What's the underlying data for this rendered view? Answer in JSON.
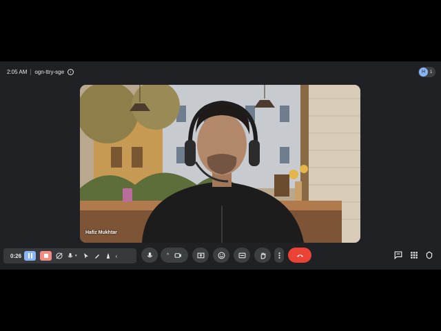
{
  "meeting": {
    "time": "2:05 AM",
    "code": "ogn-ttry-sge",
    "participant_initial": "H",
    "participant_count": "1"
  },
  "tile": {
    "name": "Hafiz Mukhtar"
  },
  "recorder": {
    "elapsed": "0:26"
  },
  "controls": {
    "mic_icon": "mic-icon",
    "camera_icon": "camera-icon",
    "present_icon": "present-icon",
    "emoji_icon": "emoji-icon",
    "captions_icon": "captions-icon",
    "hand_icon": "raise-hand-icon",
    "more_icon": "more-vert-icon",
    "end_icon": "end-call-icon"
  },
  "colors": {
    "end_call": "#ea4335",
    "pause": "#8ab4f8",
    "stop": "#f28b82",
    "bar": "#202124"
  }
}
